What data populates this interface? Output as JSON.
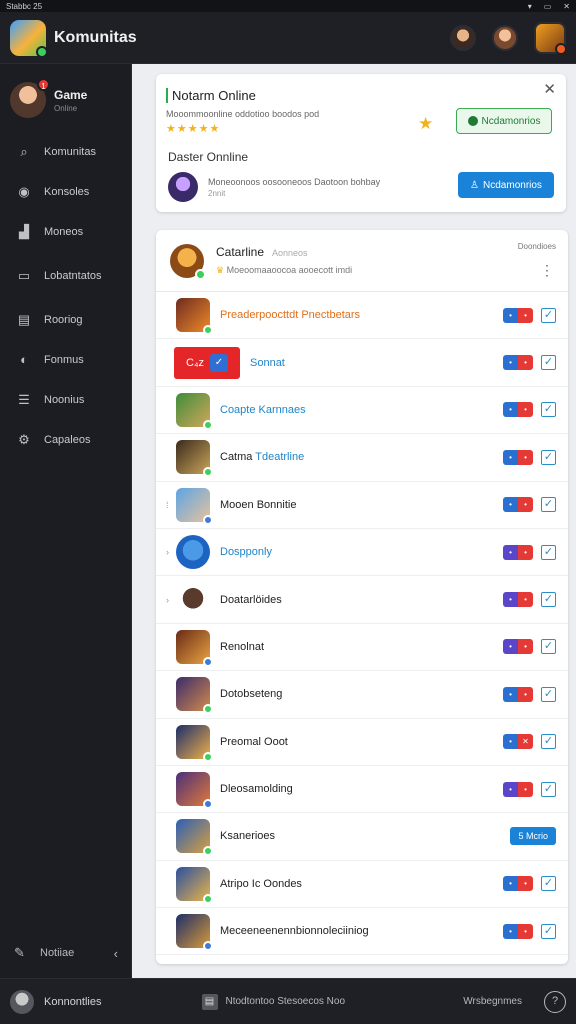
{
  "status_bar": {
    "left": "Stabbc 25",
    "icons": [
      "wifi-icon",
      "battery-icon",
      "close-icon"
    ]
  },
  "header": {
    "title": "Komunitas",
    "avatars": [
      "user-avatar-1",
      "user-avatar-2",
      "game-avatar"
    ]
  },
  "sidebar": {
    "profile": {
      "name": "Game",
      "sub": "Online",
      "badge": "1"
    },
    "items": [
      {
        "label": "Komunitas",
        "icon": "search-icon"
      },
      {
        "label": "Konsoles",
        "icon": "camera-icon"
      },
      {
        "label": "Moneos",
        "icon": "chart-icon"
      },
      {
        "label": "Lobatntatos",
        "icon": "monitor-icon"
      },
      {
        "label": "Rooriog",
        "icon": "chat-icon"
      },
      {
        "label": "Fonmus",
        "icon": "gamepad-icon"
      },
      {
        "label": "Noonius",
        "icon": "list-icon"
      },
      {
        "label": "Capaleos",
        "icon": "gear-icon"
      }
    ],
    "bottom": {
      "label": "Notiiae",
      "icon": "pen-icon",
      "chevron": "‹"
    }
  },
  "online_card": {
    "title": "Notarm Online",
    "desc": "Mooommoonline oddotioo boodos pod",
    "stars": "★★★★★",
    "green_button": "Ncdamonrios",
    "subtitle": "Daster Onnline",
    "row_text": "Moneoonoos oosooneoos Daotoon bohbay",
    "row_sub": "2nnit",
    "blue_button": "Ncdamonrios"
  },
  "list": {
    "header": {
      "title": "Catarline",
      "title_tag": "Aonneos",
      "desc": "Moeoomaaoocoa aooecott imdi",
      "right": "Doondioes",
      "more": "⋮"
    },
    "rows": [
      {
        "label": "Preaderpoocttdt Pnectbetars",
        "style": "orange",
        "lead": "",
        "colors": [
          "#6d2b1f",
          "#f08a2b"
        ],
        "action": "pill",
        "pill_l": "•",
        "pill_r": "•"
      },
      {
        "label": "Sonnat",
        "style": "blue",
        "lead": "",
        "chip": "C₄ᴢ",
        "action": "pill",
        "pill_l": "•",
        "pill_r": "•"
      },
      {
        "label": "Coapte Karnnaes",
        "style": "blue",
        "lead": "",
        "colors": [
          "#3f8d3b",
          "#d2a75a"
        ],
        "action": "pill",
        "pill_l": "•",
        "pill_r": "•"
      },
      {
        "label": "Catma",
        "label2": "Tdeatrline",
        "style": "mixed",
        "lead": "",
        "colors": [
          "#3a2a1c",
          "#caa55a"
        ],
        "action": "pill",
        "pill_l": "•",
        "pill_r": "•"
      },
      {
        "label": "Mooen Bonnitie",
        "style": "",
        "lead": "⁞",
        "colors": [
          "#5ca4e5",
          "#e6c39d"
        ],
        "action": "pill",
        "pill_l": "•",
        "pill_r": "•"
      },
      {
        "label": "Dospponly",
        "style": "blue",
        "lead": "›",
        "round": true,
        "colors": [
          "#1c63c2",
          "#4b9ae8"
        ],
        "action": "pill",
        "pill_l": "•",
        "pill_r": "•",
        "purple": true
      },
      {
        "label": "Doatarlöides",
        "style": "",
        "lead": "›",
        "round": true,
        "colors": [
          "#ffffff",
          "#5a3a2d"
        ],
        "action": "pill",
        "pill_l": "•",
        "pill_r": "•",
        "purple": true
      },
      {
        "label": "Renolnat",
        "style": "",
        "lead": "",
        "colors": [
          "#6a2a16",
          "#e9a542"
        ],
        "action": "pill",
        "pill_l": "•",
        "pill_r": "•",
        "purple": true
      },
      {
        "label": "Dotobseteng",
        "style": "",
        "lead": "",
        "colors": [
          "#3a2c6a",
          "#d38a4d"
        ],
        "action": "pill",
        "pill_l": "•",
        "pill_r": "•"
      },
      {
        "label": "Preomal Ooot",
        "style": "",
        "lead": "",
        "colors": [
          "#1c2e6a",
          "#f0b04a"
        ],
        "action": "pill",
        "pill_l": "•",
        "pill_r": "✕"
      },
      {
        "label": "Dleosamolding",
        "style": "",
        "lead": "",
        "colors": [
          "#4b2f7a",
          "#e07a3a"
        ],
        "action": "pill",
        "pill_l": "•",
        "pill_r": "•",
        "purple": true
      },
      {
        "label": "Ksanerioes",
        "style": "",
        "lead": "",
        "colors": [
          "#2a5fb8",
          "#d9a040"
        ],
        "action": "button",
        "button": "5 Mcrio"
      },
      {
        "label": "Atripo Ic Oondes",
        "style": "",
        "lead": "",
        "colors": [
          "#2a4fa0",
          "#e9b54a"
        ],
        "action": "pill",
        "pill_l": "•",
        "pill_r": "•"
      },
      {
        "label": "Meceeneenennbionnoleciiniog",
        "style": "",
        "lead": "",
        "colors": [
          "#1d2f6a",
          "#d89a3a"
        ],
        "action": "pill",
        "pill_l": "•",
        "pill_r": "•"
      }
    ]
  },
  "bottom_bar": {
    "left_label": "Konnontlies",
    "mid_icon": "📁",
    "mid_label": "Ntodtontoo Stesoecos Noo",
    "right_label": "Wrsbegnmes",
    "right_icon": "?"
  }
}
